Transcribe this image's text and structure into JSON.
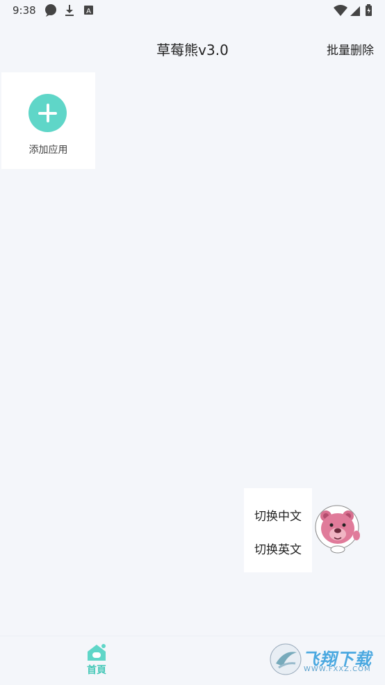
{
  "status_bar": {
    "time": "9:38",
    "left_icons": [
      "chat-bubble-icon",
      "download-icon",
      "a-square-icon"
    ],
    "right_icons": [
      "wifi-icon",
      "signal-icon",
      "battery-icon"
    ]
  },
  "header": {
    "title": "草莓熊v3.0",
    "batch_delete_label": "批量删除"
  },
  "add_app": {
    "label": "添加应用",
    "icon": "plus-icon",
    "accent_color": "#5fd6c8"
  },
  "language_menu": {
    "items": [
      {
        "label": "切换中文"
      },
      {
        "label": "切换英文"
      }
    ]
  },
  "bottom_nav": {
    "items": [
      {
        "label": "首頁",
        "icon": "home-icon",
        "active": true
      }
    ],
    "active_color": "#46c8b8"
  },
  "watermark": {
    "brand": "飞翔下载",
    "url": "WWW.FXXZ.COM"
  }
}
